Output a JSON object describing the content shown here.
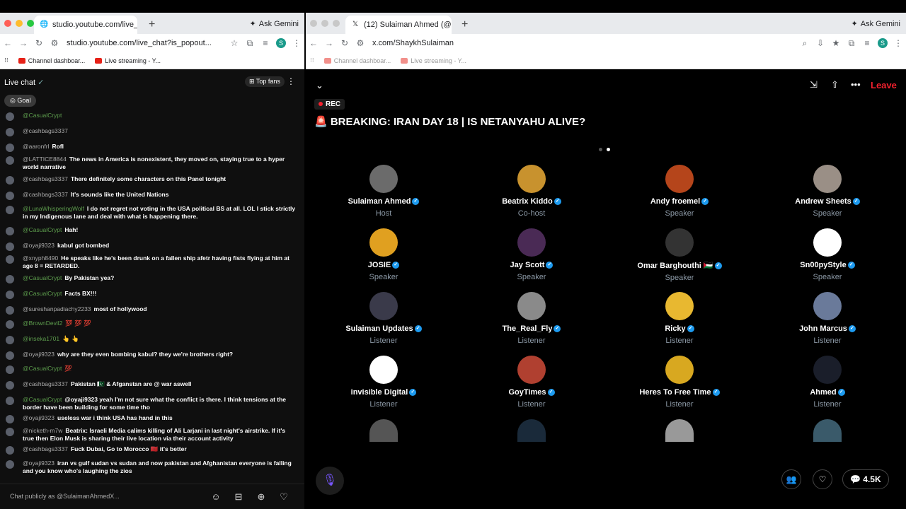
{
  "left_window": {
    "tab_title": "studio.youtube.com/live_chat",
    "ask_gemini": "Ask Gemini",
    "url": "studio.youtube.com/live_chat?is_popout...",
    "bookmarks": [
      "Channel dashboar...",
      "Live streaming - Y..."
    ],
    "chat_title": "Live chat",
    "top_fans": "Top fans",
    "goal": "Goal",
    "messages": [
      {
        "author": "@CasualCrypt",
        "text": "",
        "mod": true
      },
      {
        "author": "@cashbags3337",
        "text": "",
        "mod": false
      },
      {
        "author": "@aaronfrl",
        "text": "Rofl",
        "mod": false
      },
      {
        "author": "@LATTICE8844",
        "text": "The news in America is nonexistent, they moved on, staying true to a hyper world narrative",
        "mod": false
      },
      {
        "author": "@cashbags3337",
        "text": "There definitely some characters on this Panel tonight",
        "mod": false
      },
      {
        "author": "@cashbags3337",
        "text": "It's sounds like the United Nations",
        "mod": false
      },
      {
        "author": "@LunaWhisperingWolf",
        "text": "I do not regret not voting in the USA political BS at all. LOL I stick strictly in my Indigenous lane and deal with what is happening there.",
        "mod": true
      },
      {
        "author": "@CasualCrypt",
        "text": "Hah!",
        "mod": true
      },
      {
        "author": "@oyaji9323",
        "text": "kabul got bombed",
        "mod": false
      },
      {
        "author": "@xnyph8490",
        "text": "He speaks like he's been drunk on a fallen ship afetr having fists flying at him at age 8 = RETARDED.",
        "mod": false
      },
      {
        "author": "@CasualCrypt",
        "text": "By Pakistan yea?",
        "mod": true
      },
      {
        "author": "@CasualCrypt",
        "text": "Facts BX!!!",
        "mod": true
      },
      {
        "author": "@sureshanpadiachy2233",
        "text": "most of hollywood",
        "mod": false
      },
      {
        "author": "@BrownDevil2",
        "text": "💯 💯 💯",
        "mod": true
      },
      {
        "author": "@inseka1701",
        "text": "👆 👆",
        "mod": true
      },
      {
        "author": "@oyaji9323",
        "text": "why are they even bombing kabul? they we're brothers right?",
        "mod": false
      },
      {
        "author": "@CasualCrypt",
        "text": "💯",
        "mod": true
      },
      {
        "author": "@cashbags3337",
        "text": "Pakistan 🇵🇰 & Afganstan are @ war aswell",
        "mod": false
      },
      {
        "author": "@CasualCrypt",
        "text": "@oyaji9323 yeah I'm not sure what the conflict is there. I think tensions at the border have been building for some time tho",
        "mod": true
      },
      {
        "author": "@oyaji9323",
        "text": "useless war i think USA has hand in this",
        "mod": false
      },
      {
        "author": "@nicketh-m7w",
        "text": "Beatrix: Israeli Media calims killing of Ali Larjani in last night's airstrike. If it's true then Elon Musk is sharing their live location via their account activity",
        "mod": false
      },
      {
        "author": "@cashbags3337",
        "text": "Fuck Dubai, Go to Morocco 🇲🇦 it's better",
        "mod": false
      },
      {
        "author": "@oyaji9323",
        "text": "iran vs gulf sudan vs sudan and now pakistan and Afghanistan everyone is falling and you know who's laughing the zios",
        "mod": false
      }
    ],
    "chat_placeholder": "Chat publicly as @SulaimanAhmedX..."
  },
  "right_window": {
    "tab_title": "(12) Sulaiman Ahmed (@",
    "ask_gemini": "Ask Gemini",
    "url": "x.com/ShaykhSulaiman",
    "bookmarks": [
      "Channel dashboar...",
      "Live streaming - Y..."
    ],
    "leave": "Leave",
    "rec": "REC",
    "title": "🚨 BREAKING: IRAN DAY 18 | IS NETANYAHU ALIVE?",
    "participants": [
      {
        "name": "Sulaiman Ahmed",
        "role": "Host",
        "color": "#6b6b6b"
      },
      {
        "name": "Beatrix Kiddo",
        "role": "Co-host",
        "color": "#c8922e"
      },
      {
        "name": "Andy froemel",
        "role": "Speaker",
        "color": "#b5451b"
      },
      {
        "name": "Andrew Sheets",
        "role": "Speaker",
        "color": "#9a8f86"
      },
      {
        "name": "JOSIE",
        "role": "Speaker",
        "color": "#e0a020"
      },
      {
        "name": "Jay Scott",
        "role": "Speaker",
        "color": "#4a2a55"
      },
      {
        "name": "Omar Barghouthi 🇵🇸",
        "role": "Speaker",
        "color": "#333333"
      },
      {
        "name": "Sn00pyStyle",
        "role": "Speaker",
        "color": "#ffffff"
      },
      {
        "name": "Sulaiman Updates",
        "role": "Listener",
        "color": "#3a3a4a"
      },
      {
        "name": "The_Real_Fly",
        "role": "Listener",
        "color": "#8a8a8a"
      },
      {
        "name": "Ricky",
        "role": "Listener",
        "color": "#e8b830"
      },
      {
        "name": "John Marcus",
        "role": "Listener",
        "color": "#6a7a9a"
      },
      {
        "name": "invisible Digital",
        "role": "Listener",
        "color": "#ffffff"
      },
      {
        "name": "GoyTimes",
        "role": "Listener",
        "color": "#b04030"
      },
      {
        "name": "Heres To Free Time",
        "role": "Listener",
        "color": "#d8a820"
      },
      {
        "name": "Ahmed",
        "role": "Listener",
        "color": "#1a1e2a"
      }
    ],
    "partial_row_colors": [
      "#555555",
      "#1a2a3a",
      "#999999",
      "#3a5a6a"
    ],
    "listener_count": "4.5K"
  }
}
